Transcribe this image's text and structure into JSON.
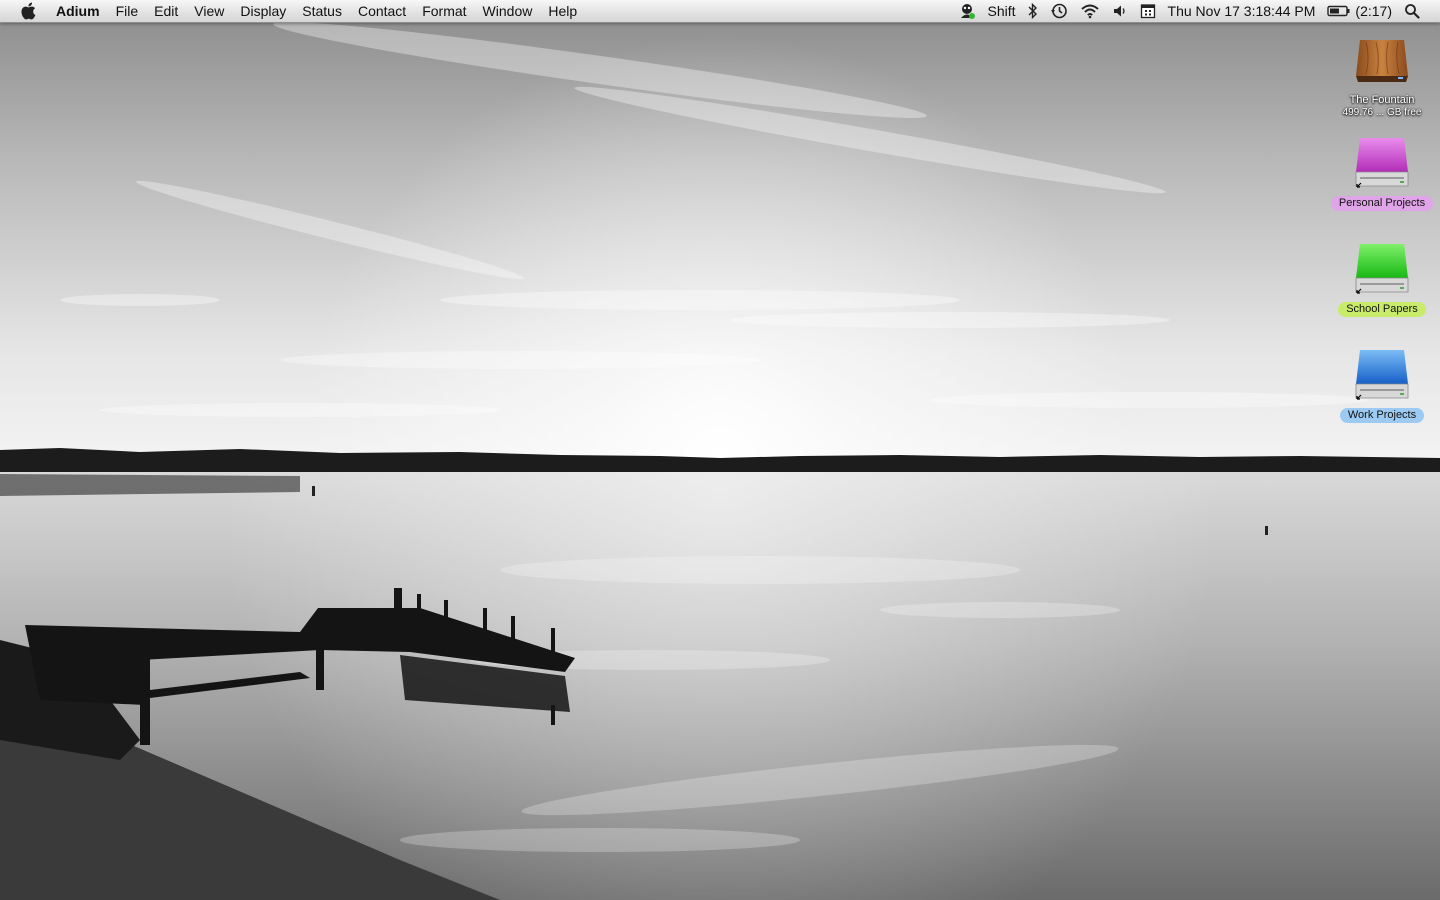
{
  "menubar": {
    "app_name": "Adium",
    "items": [
      "File",
      "Edit",
      "View",
      "Display",
      "Status",
      "Contact",
      "Format",
      "Window",
      "Help"
    ],
    "status": {
      "adium_icon": "adium-duck-icon",
      "shift_label": "Shift",
      "bluetooth_icon": "bluetooth-icon",
      "timemachine_icon": "time-machine-icon",
      "wifi_icon": "wifi-icon",
      "volume_icon": "volume-icon",
      "calendar_icon": "calendar-icon",
      "datetime": "Thu Nov 17  3:18:44 PM",
      "battery_icon": "battery-icon",
      "battery_time": "(2:17)",
      "spotlight_icon": "spotlight-icon"
    }
  },
  "desktop": {
    "icons": [
      {
        "name": "The Fountain",
        "subtitle": "499.76 ... GB free",
        "color": "#b06a2e",
        "label_color": ""
      },
      {
        "name": "Personal Projects",
        "subtitle": "",
        "color": "#d24fd6",
        "label_color": "#e0a4e8"
      },
      {
        "name": "School Papers",
        "subtitle": "",
        "color": "#3ed12e",
        "label_color": "#c8ec6a"
      },
      {
        "name": "Work Projects",
        "subtitle": "",
        "color": "#2f7fd8",
        "label_color": "#9ccaf2"
      }
    ]
  }
}
